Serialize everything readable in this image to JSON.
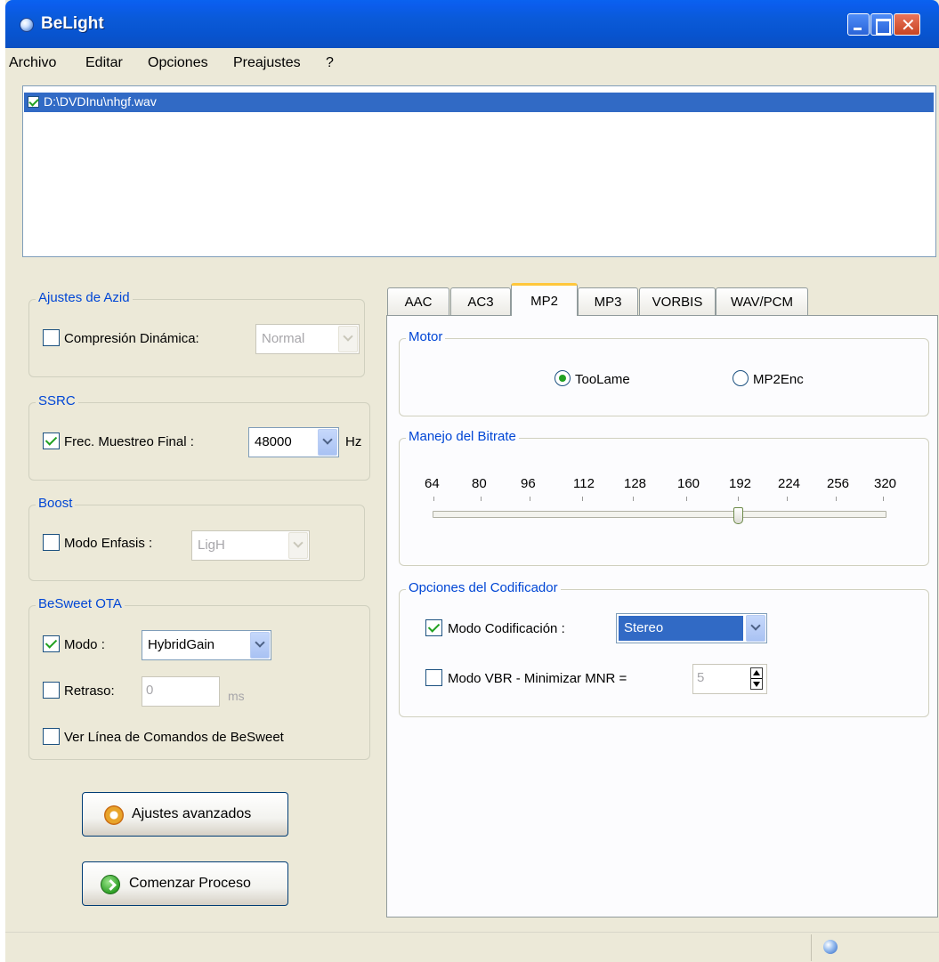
{
  "window": {
    "title": "BeLight"
  },
  "menu": [
    "Archivo",
    "Editar",
    "Opciones",
    "Preajustes",
    "?"
  ],
  "file_list": {
    "items": [
      {
        "path": "D:\\DVDInu\\nhgf.wav",
        "checked": true
      }
    ]
  },
  "azid": {
    "title": "Ajustes de Azid",
    "compresion_label": "Compresión Dinámica:",
    "compresion_checked": false,
    "compresion_value": "Normal"
  },
  "ssrc": {
    "title": "SSRC",
    "frec_label": "Frec. Muestreo Final :",
    "frec_checked": true,
    "frec_value": "48000",
    "unit": "Hz"
  },
  "boost": {
    "title": "Boost",
    "enfasis_label": "Modo Enfasis :",
    "enfasis_checked": false,
    "enfasis_value": "LigH"
  },
  "besweet": {
    "title": "BeSweet OTA",
    "modo_label": "Modo :",
    "modo_checked": true,
    "modo_value": "HybridGain",
    "retraso_label": "Retraso:",
    "retraso_checked": false,
    "retraso_value": "0",
    "retraso_unit": "ms",
    "ver_linea_label": "Ver Línea de Comandos de BeSweet",
    "ver_linea_checked": false
  },
  "buttons": {
    "advanced": "Ajustes avanzados",
    "start": "Comenzar Proceso"
  },
  "tabs": [
    {
      "label": "AAC",
      "active": false
    },
    {
      "label": "AC3",
      "active": false
    },
    {
      "label": "MP2",
      "active": true
    },
    {
      "label": "MP3",
      "active": false
    },
    {
      "label": "VORBIS",
      "active": false
    },
    {
      "label": "WAV/PCM",
      "active": false
    }
  ],
  "motor": {
    "title": "Motor",
    "options": [
      {
        "label": "TooLame",
        "selected": true
      },
      {
        "label": "MP2Enc",
        "selected": false
      }
    ]
  },
  "bitrate": {
    "title": "Manejo del Bitrate",
    "ticks": [
      "64",
      "80",
      "96",
      "112",
      "128",
      "160",
      "192",
      "224",
      "256",
      "320"
    ],
    "selected": "192"
  },
  "codificador": {
    "title": "Opciones del Codificador",
    "modo_label": "Modo Codificación :",
    "modo_checked": true,
    "modo_value": "Stereo",
    "vbr_label": "Modo VBR - Minimizar MNR =",
    "vbr_checked": false,
    "vbr_value": "5"
  },
  "colors": {
    "titlebar": "#0a5ad8",
    "selection": "#316ac5",
    "group_label": "#0046d5",
    "tab_highlight": "#ffc73c",
    "check": "#21a121"
  }
}
